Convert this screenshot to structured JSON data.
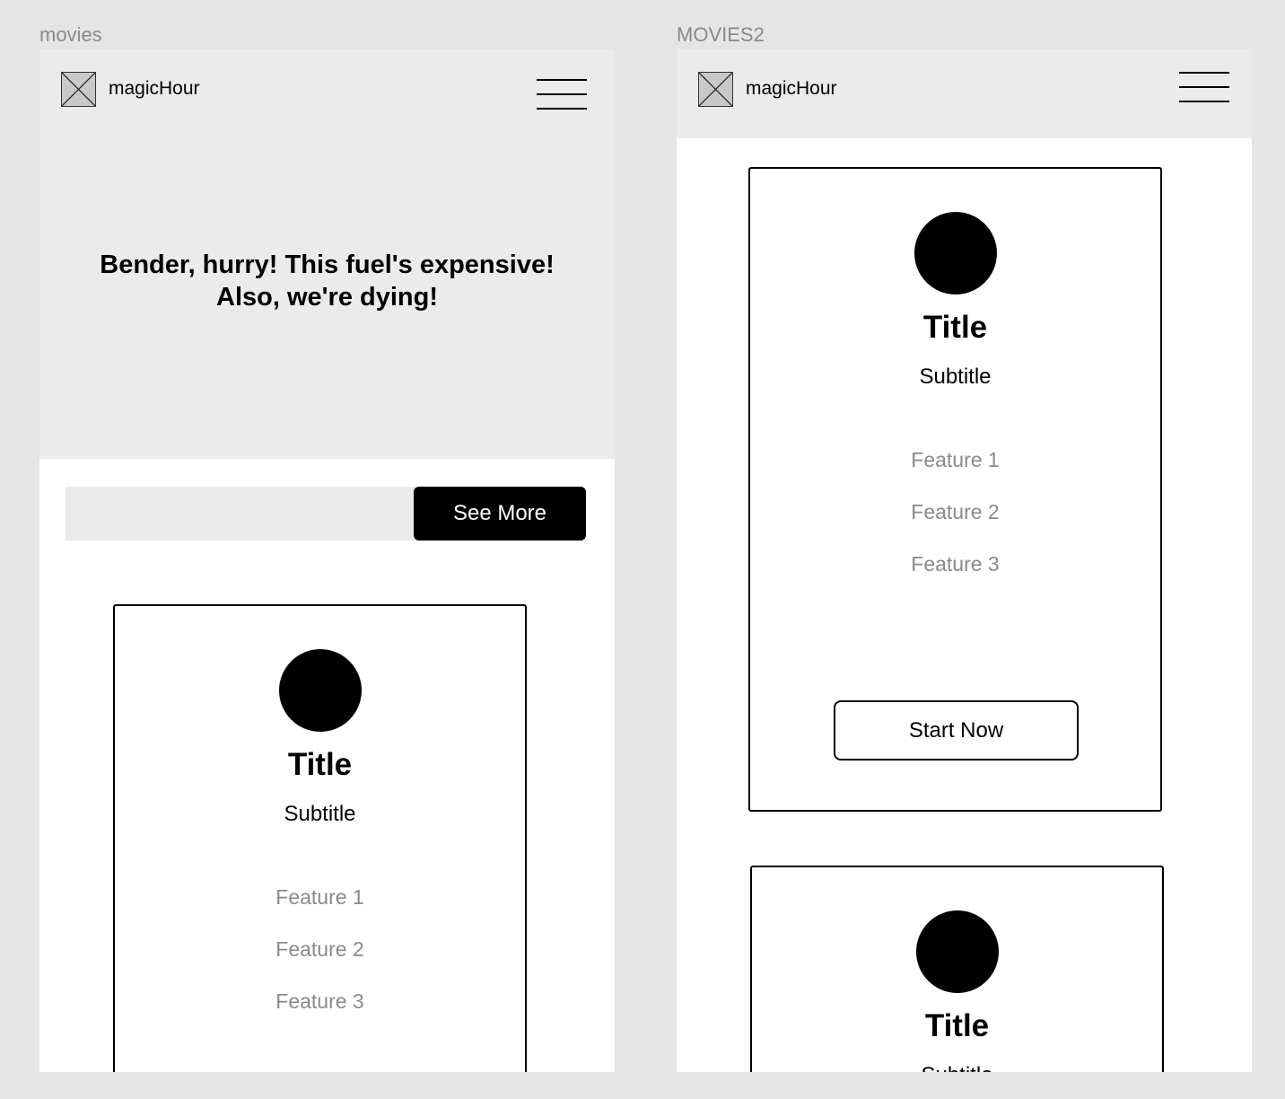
{
  "frames": {
    "left": {
      "label": "movies",
      "navbar": {
        "brand": "magicHour",
        "logo_icon": "image-placeholder-icon",
        "menu_icon": "hamburger-menu-icon"
      },
      "hero": {
        "line1": "Bender, hurry! This fuel's expensive!",
        "line2": "Also, we're dying!"
      },
      "search": {
        "value": "",
        "placeholder": ""
      },
      "cta": {
        "label": "See More"
      },
      "card": {
        "title": "Title",
        "subtitle": "Subtitle",
        "features": [
          "Feature 1",
          "Feature 2",
          "Feature 3"
        ]
      }
    },
    "right": {
      "label": "MOVIES2",
      "navbar": {
        "brand": "magicHour",
        "logo_icon": "image-placeholder-icon",
        "menu_icon": "hamburger-menu-icon"
      },
      "cards": [
        {
          "title": "Title",
          "subtitle": "Subtitle",
          "features": [
            "Feature 1",
            "Feature 2",
            "Feature 3"
          ],
          "button": "Start Now"
        },
        {
          "title": "Title",
          "subtitle": "Subtitle"
        }
      ]
    }
  }
}
